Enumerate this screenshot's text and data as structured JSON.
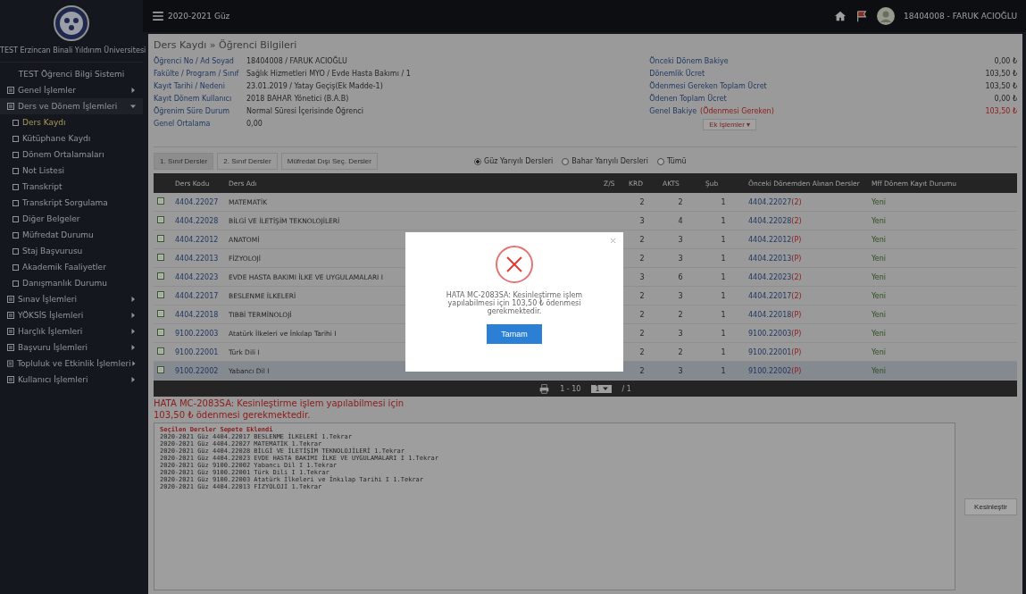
{
  "sidebar": {
    "university": "TEST Erzincan Binali Yıldırım Üniversitesi",
    "system": "TEST Öğrenci Bilgi Sistemi",
    "menu": [
      {
        "label": "Genel İşlemler",
        "expanded": false
      },
      {
        "label": "Ders ve Dönem İşlemleri",
        "expanded": true,
        "children": [
          {
            "label": "Ders Kaydı",
            "selected": true
          },
          {
            "label": "Kütüphane Kaydı",
            "selected": false
          },
          {
            "label": "Dönem Ortalamaları",
            "selected": false
          },
          {
            "label": "Not Listesi",
            "selected": false
          },
          {
            "label": "Transkript",
            "selected": false
          },
          {
            "label": "Transkript Sorgulama",
            "selected": false
          },
          {
            "label": "Diğer Belgeler",
            "selected": false
          },
          {
            "label": "Müfredat Durumu",
            "selected": false
          },
          {
            "label": "Staj Başvurusu",
            "selected": false
          },
          {
            "label": "Akademik Faaliyetler",
            "selected": false
          },
          {
            "label": "Danışmanlık Durumu",
            "selected": false
          }
        ]
      },
      {
        "label": "Sınav İşlemleri",
        "expanded": false
      },
      {
        "label": "YÖKSİS İşlemleri",
        "expanded": false
      },
      {
        "label": "Harçlık İşlemleri",
        "expanded": false
      },
      {
        "label": "Başvuru İşlemleri",
        "expanded": false
      },
      {
        "label": "Topluluk ve Etkinlik İşlemleri",
        "expanded": false
      },
      {
        "label": "Kullanıcı İşlemleri",
        "expanded": false
      }
    ]
  },
  "topbar": {
    "term": "2020-2021 Güz",
    "user": "18404008 - FARUK ACIOĞLU"
  },
  "panel": {
    "title": "Ders Kaydı » Öğrenci Bilgileri",
    "info_left": [
      {
        "label": "Öğrenci No / Ad Soyad",
        "value": "18404008 / FARUK ACIOĞLU"
      },
      {
        "label": "Fakülte / Program / Sınıf",
        "value": "Sağlık Hizmetleri MYO / Evde Hasta Bakımı / 1"
      },
      {
        "label": "Kayıt Tarihi / Nedeni",
        "value": "23.01.2019 / Yatay Geçiş(Ek Madde-1)"
      },
      {
        "label": "Kayıt Dönem Kullanıcı",
        "value": "2018 BAHAR Yönetici (B.A.B)"
      },
      {
        "label": "Öğrenim Süre Durum",
        "value": "Normal Süresi İçerisinde Öğrenci"
      },
      {
        "label": "Genel Ortalama",
        "value": "0,00"
      }
    ],
    "info_right": [
      {
        "label": "Önceki Dönem Bakiye",
        "value": "0,00 ₺",
        "kind": "normal"
      },
      {
        "label": "Dönemlik Ücret",
        "value": "103,50 ₺",
        "kind": "normal"
      },
      {
        "label": "Ödenmesi Gereken Toplam Ücret",
        "value": "103,50 ₺",
        "kind": "normal"
      },
      {
        "label": "Ödenen Toplam Ücret",
        "value": "0,00 ₺",
        "kind": "normal"
      },
      {
        "label": "Genel Bakiye",
        "note": "(Ödenmesi Gereken)",
        "value": "103,50 ₺",
        "kind": "alert"
      }
    ],
    "actions_button": "Ek İşlemler ▾"
  },
  "tabs": [
    {
      "label": "1. Sınıf Dersler",
      "selected": true
    },
    {
      "label": "2. Sınıf Dersler",
      "selected": false
    },
    {
      "label": "Müfredat Dışı Seç. Dersler",
      "selected": false
    }
  ],
  "radios": [
    {
      "label": "Güz Yarıyılı Dersleri",
      "selected": true
    },
    {
      "label": "Bahar Yarıyılı Dersleri",
      "selected": false
    },
    {
      "label": "Tümü",
      "selected": false
    }
  ],
  "table": {
    "columns": [
      "Ders Kodu",
      "Ders Adı",
      "Z/S",
      "KRD",
      "AKTS",
      "Şub",
      "Önceki Dönemden Alınan Dersler",
      "Mff Dönem Kayıt Durumu"
    ],
    "rows": [
      {
        "checked": true,
        "selected": false,
        "code": "4404.22027",
        "name": "MATEMATİK",
        "krd": "2",
        "akts": "2",
        "sub": "1",
        "prev": "4404.22027",
        "prev_mark": "(2)",
        "status": "Yeni"
      },
      {
        "checked": true,
        "selected": false,
        "code": "4404.22028",
        "name": "BİLGİ VE İLETİŞİM TEKNOLOJİLERİ",
        "krd": "3",
        "akts": "4",
        "sub": "1",
        "prev": "4404.22028",
        "prev_mark": "(2)",
        "status": "Yeni"
      },
      {
        "checked": true,
        "selected": false,
        "code": "4404.22012",
        "name": "ANATOMİ",
        "krd": "2",
        "akts": "3",
        "sub": "1",
        "prev": "4404.22012",
        "prev_mark": "(P)",
        "status": "Yeni"
      },
      {
        "checked": true,
        "selected": false,
        "code": "4404.22013",
        "name": "FİZYOLOJİ",
        "krd": "2",
        "akts": "3",
        "sub": "1",
        "prev": "4404.22013",
        "prev_mark": "(P)",
        "status": "Yeni"
      },
      {
        "checked": true,
        "selected": false,
        "code": "4404.22023",
        "name": "EVDE HASTA BAKIMI İLKE VE UYGULAMALARI I",
        "krd": "3",
        "akts": "6",
        "sub": "1",
        "prev": "4404.22023",
        "prev_mark": "(2)",
        "status": "Yeni"
      },
      {
        "checked": true,
        "selected": false,
        "code": "4404.22017",
        "name": "BESLENME İLKELERİ",
        "krd": "2",
        "akts": "3",
        "sub": "1",
        "prev": "4404.22017",
        "prev_mark": "(2)",
        "status": "Yeni"
      },
      {
        "checked": true,
        "selected": false,
        "code": "4404.22018",
        "name": "TIBBİ TERMİNOLOJİ",
        "krd": "2",
        "akts": "2",
        "sub": "1",
        "prev": "4404.22018",
        "prev_mark": "(P)",
        "status": "Yeni"
      },
      {
        "checked": true,
        "selected": false,
        "code": "9100.22003",
        "name": "Atatürk İlkeleri ve İnkılap Tarihi I",
        "krd": "2",
        "akts": "3",
        "sub": "1",
        "prev": "9100.22003",
        "prev_mark": "(P)",
        "status": "Yeni"
      },
      {
        "checked": true,
        "selected": false,
        "code": "9100.22001",
        "name": "Türk Dili I",
        "krd": "2",
        "akts": "2",
        "sub": "1",
        "prev": "9100.22001",
        "prev_mark": "(P)",
        "status": "Yeni"
      },
      {
        "checked": true,
        "selected": true,
        "code": "9100.22002",
        "name": "Yabancı Dil I",
        "krd": "2",
        "akts": "3",
        "sub": "1",
        "prev": "9100.22002",
        "prev_mark": "(P)",
        "status": "Yeni"
      }
    ]
  },
  "pager": {
    "range": "1 - 10",
    "page": "1",
    "total": "/ 1"
  },
  "error_lines": [
    "HATA MC-2083SA: Kesinleştirme işlem yapılabilmesi için",
    "103,50 ₺ ödenmesi gerekmektedir."
  ],
  "log": {
    "title": "Seçilen Dersler Sepete Eklendi",
    "lines": [
      "2020-2021 Güz 4404.22017 BESLENME İLKELERİ 1.Tekrar",
      "2020-2021 Güz 4404.22027 MATEMATİK 1.Tekrar",
      "2020-2021 Güz 4404.22028 BİLGİ VE İLETİŞİM TEKNOLOJİLERİ 1.Tekrar",
      "2020-2021 Güz 4404.22023 EVDE HASTA BAKIMI İLKE VE UYGULAMALARI I 1.Tekrar",
      "2020-2021 Güz 9100.22002 Yabancı Dil I 1.Tekrar",
      "2020-2021 Güz 9100.22001 Türk Dili I 1.Tekrar",
      "2020-2021 Güz 9100.22003 Atatürk İlkeleri ve İnkılap Tarihi I 1.Tekrar",
      "2020-2021 Güz 4404.22013 FİZYOLOJİ 1.Tekrar"
    ]
  },
  "confirm_button": "Kesinleştir",
  "modal": {
    "message": "HATA MC-2083SA: Kesinleştirme işlem yapılabilmesi için 103,50 ₺ ödenmesi gerekmektedir.",
    "button": "Tamam"
  }
}
